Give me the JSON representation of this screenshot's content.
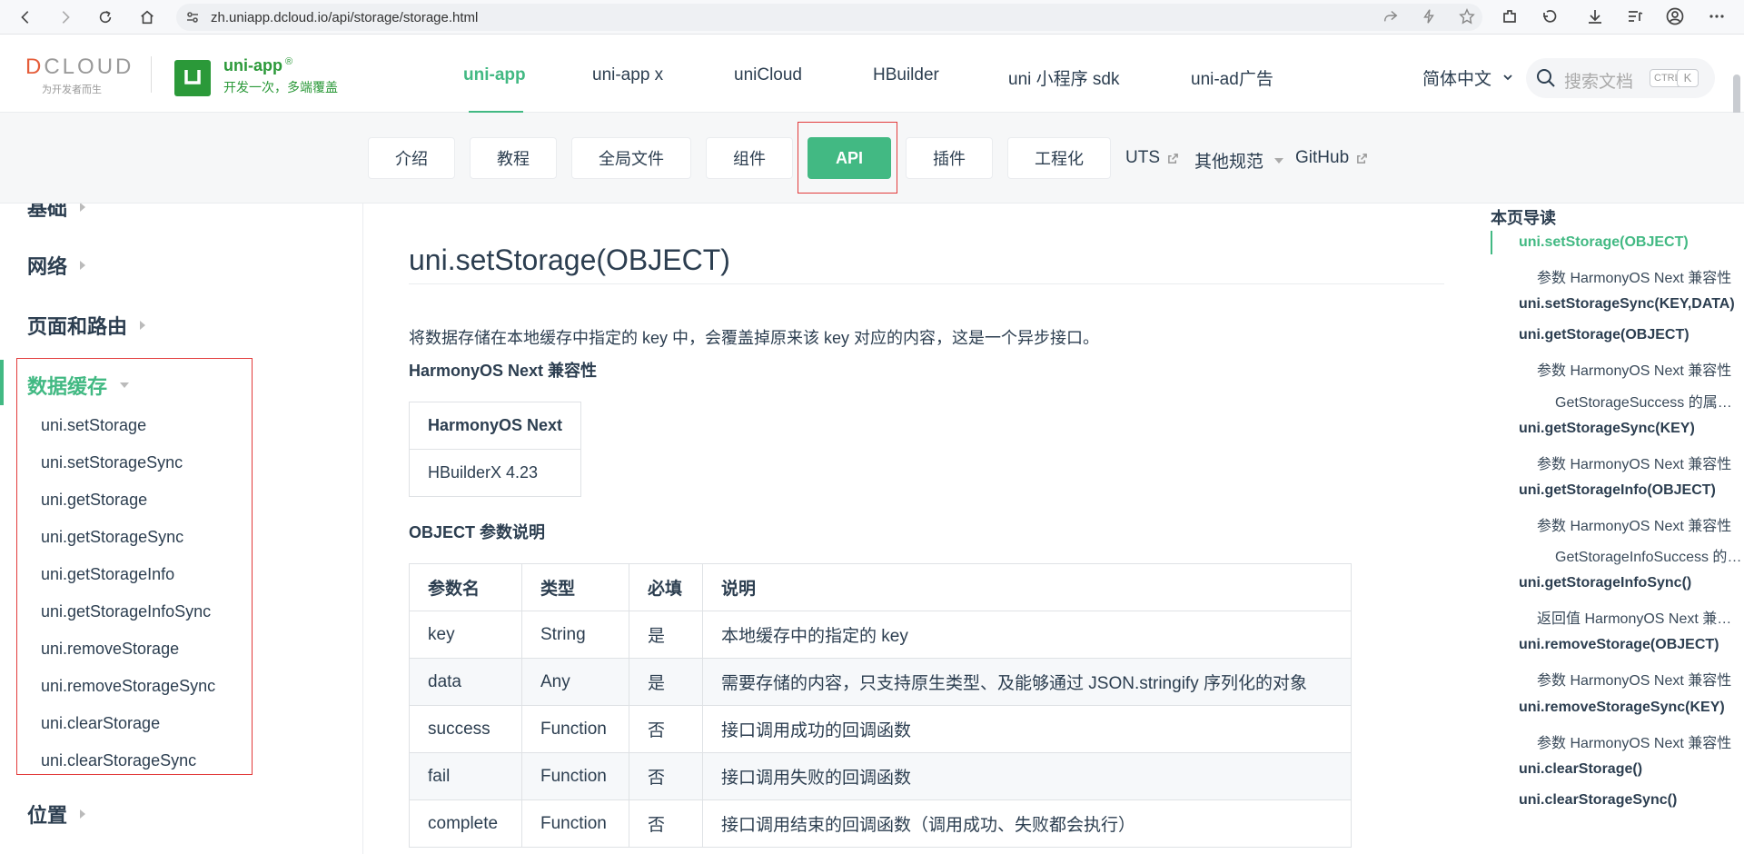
{
  "browser": {
    "url": "zh.uniapp.dcloud.io/api/storage/storage.html"
  },
  "header": {
    "dcloud_tagline": "为开发者而生",
    "product_name": "uni-app",
    "product_mark": "®",
    "product_slogan": "开发一次，多端覆盖",
    "nav": [
      "uni-app",
      "uni-app x",
      "uniCloud",
      "HBuilder",
      "uni 小程序 sdk",
      "uni-ad广告"
    ],
    "active_nav": "uni-app",
    "language": "简体中文",
    "search_placeholder": "搜索文档",
    "kbd_ctrl": "CTRL",
    "kbd_k": "K"
  },
  "subnav": {
    "pills": [
      "介绍",
      "教程",
      "全局文件",
      "组件",
      "API",
      "插件",
      "工程化"
    ],
    "active": "API",
    "links": [
      "UTS",
      "其他规范",
      "GitHub"
    ]
  },
  "sidebar": {
    "partial_top": "基础",
    "sections": [
      "网络",
      "页面和路由",
      "数据缓存",
      "位置"
    ],
    "open_section": "数据缓存",
    "items": [
      "uni.setStorage",
      "uni.setStorageSync",
      "uni.getStorage",
      "uni.getStorageSync",
      "uni.getStorageInfo",
      "uni.getStorageInfoSync",
      "uni.removeStorage",
      "uni.removeStorageSync",
      "uni.clearStorage",
      "uni.clearStorageSync"
    ]
  },
  "main": {
    "title": "uni.setStorage(OBJECT)",
    "description": "将数据存储在本地缓存中指定的 key 中，会覆盖掉原来该 key 对应的内容，这是一个异步接口。",
    "compat_heading": "HarmonyOS Next 兼容性",
    "compat_table": {
      "header": "HarmonyOS Next",
      "value": "HBuilderX 4.23"
    },
    "object_heading": "OBJECT 参数说明",
    "params_headers": [
      "参数名",
      "类型",
      "必填",
      "说明"
    ],
    "params_rows": [
      [
        "key",
        "String",
        "是",
        "本地缓存中的指定的 key"
      ],
      [
        "data",
        "Any",
        "是",
        "需要存储的内容，只支持原生类型、及能够通过 JSON.stringify 序列化的对象"
      ],
      [
        "success",
        "Function",
        "否",
        "接口调用成功的回调函数"
      ],
      [
        "fail",
        "Function",
        "否",
        "接口调用失败的回调函数"
      ],
      [
        "complete",
        "Function",
        "否",
        "接口调用结束的回调函数（调用成功、失败都会执行）"
      ]
    ]
  },
  "toc": {
    "title": "本页导读",
    "items": [
      {
        "level": 1,
        "text": "uni.setStorage(OBJECT)",
        "active": true
      },
      {
        "level": 2,
        "text": "参数 HarmonyOS Next 兼容性"
      },
      {
        "level": 1,
        "text": "uni.setStorageSync(KEY,DATA)"
      },
      {
        "level": 1,
        "text": "uni.getStorage(OBJECT)"
      },
      {
        "level": 2,
        "text": "参数 HarmonyOS Next 兼容性"
      },
      {
        "level": 3,
        "text": "GetStorageSuccess 的属性值"
      },
      {
        "level": 1,
        "text": "uni.getStorageSync(KEY)"
      },
      {
        "level": 2,
        "text": "参数 HarmonyOS Next 兼容性"
      },
      {
        "level": 1,
        "text": "uni.getStorageInfo(OBJECT)"
      },
      {
        "level": 2,
        "text": "参数 HarmonyOS Next 兼容性"
      },
      {
        "level": 3,
        "text": "GetStorageInfoSuccess 的属性值"
      },
      {
        "level": 1,
        "text": "uni.getStorageInfoSync()"
      },
      {
        "level": 2,
        "text": "返回值 HarmonyOS Next 兼容性"
      },
      {
        "level": 1,
        "text": "uni.removeStorage(OBJECT)"
      },
      {
        "level": 2,
        "text": "参数 HarmonyOS Next 兼容性"
      },
      {
        "level": 1,
        "text": "uni.removeStorageSync(KEY)"
      },
      {
        "level": 2,
        "text": "参数 HarmonyOS Next 兼容性"
      },
      {
        "level": 1,
        "text": "uni.clearStorage()"
      },
      {
        "level": 1,
        "text": "uni.clearStorageSync()"
      }
    ]
  },
  "colors": {
    "accent": "#42b983",
    "brand_green": "#2b9939",
    "highlight_outline": "#e23b3b"
  }
}
